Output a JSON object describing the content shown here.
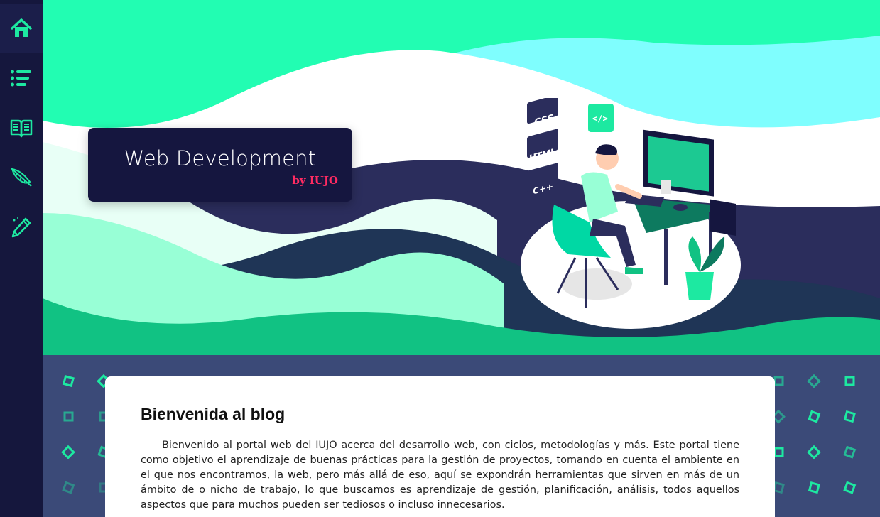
{
  "sidebar": {
    "items": [
      {
        "icon": "home-icon"
      },
      {
        "icon": "list-icon"
      },
      {
        "icon": "book-icon"
      },
      {
        "icon": "feather-icon"
      },
      {
        "icon": "pen-icon"
      }
    ],
    "accent_color": "#1de9a1",
    "background": "#15173d"
  },
  "hero": {
    "title": "Web Development",
    "subtitle": "by IUJO",
    "illustration_tags": [
      "CSS",
      "HTML",
      "C++"
    ],
    "code_badge": "</>",
    "colors": {
      "mint": "#22fdb2",
      "cyan": "#7ffefe",
      "navy": "#2b2d5c",
      "green": "#11c283"
    }
  },
  "content": {
    "heading": "Bienvenida al blog",
    "paragraph": "Bienvenido al portal web del IUJO acerca del desarrollo web, con ciclos, metodologías y más. Este portal tiene como objetivo el aprendizaje de buenas prácticas para la gestión de proyectos, tomando en cuenta el ambiente en el que nos encontramos, la web, pero más allá de eso, aquí se expondrán herramientas que sirven en más de un ámbito de o nicho de trabajo, lo que buscamos es aprendizaje de gestión, planificación, análisis, todos aquellos aspectos que para muchos pueden ser tediosos o incluso innecesarios."
  }
}
